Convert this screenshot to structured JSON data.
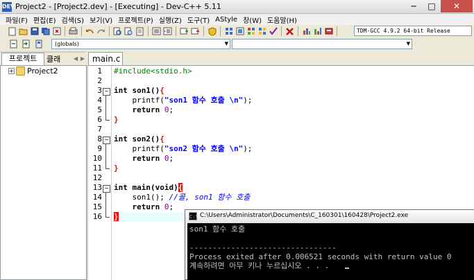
{
  "window": {
    "title": "Project2 - [Project2.dev] - [Executing] - Dev-C++ 5.11",
    "app_icon": "DEV",
    "minimize": "─",
    "maximize": "□",
    "close": "✕"
  },
  "menu": [
    "파일(F)",
    "편집(E)",
    "검색(S)",
    "보기(V)",
    "프로젝트(P)",
    "실행(Z)",
    "도구(T)",
    "AStyle",
    "창(W)",
    "도움말(H)"
  ],
  "toolbar": {
    "compiler": "TDM-GCC 4.9.2 64-bit Release",
    "globals": "(globals)"
  },
  "left_panel": {
    "tabs": [
      "프로젝트",
      "클래"
    ],
    "tree": {
      "expand": "+",
      "project": "Project2"
    }
  },
  "editor": {
    "tab": "main.c",
    "line_numbers": [
      "1",
      "2",
      "3",
      "4",
      "5",
      "6",
      "7",
      "8",
      "9",
      "10",
      "11",
      "12",
      "13",
      "14",
      "15",
      "16"
    ],
    "lines": {
      "l1_pp": "#include<stdio.h>",
      "l3_kw": "int",
      "l3_fn": " son1()",
      "l3_brace": "{",
      "l4_fn": "    printf(",
      "l4_str": "\"son1 함수 호출 \\n\"",
      "l4_end": ");",
      "l5_kw": "    return",
      "l5_num": " 0",
      "l5_end": ";",
      "l6_brace": "}",
      "l8_kw": "int",
      "l8_fn": " son2()",
      "l8_brace": "{",
      "l9_fn": "    printf(",
      "l9_str": "\"son2 함수 호출 \\n\"",
      "l9_end": ");",
      "l10_kw": "    return",
      "l10_num": " 0",
      "l10_end": ";",
      "l11_brace": "}",
      "l13_kw": "int",
      "l13_fn": " main(",
      "l13_kw2": "void",
      "l13_paren": ")",
      "l13_brace": "{",
      "l14_fn": "    son1(); ",
      "l14_cmt": "//콜, son1 함수 호출",
      "l15_kw": "    return",
      "l15_num": " 0",
      "l15_end": ";",
      "l16_brace": "}"
    }
  },
  "console": {
    "title": "C:\\Users\\Administrator\\Documents\\C_160301\\160428\\Project2.exe",
    "icon": "C:\\",
    "lines": [
      "son1 함수 호출",
      "",
      "--------------------------------",
      "Process exited after 0.006521 seconds with return value 0",
      "계속하려면 아무 키나 누르십시오 . . ."
    ]
  }
}
